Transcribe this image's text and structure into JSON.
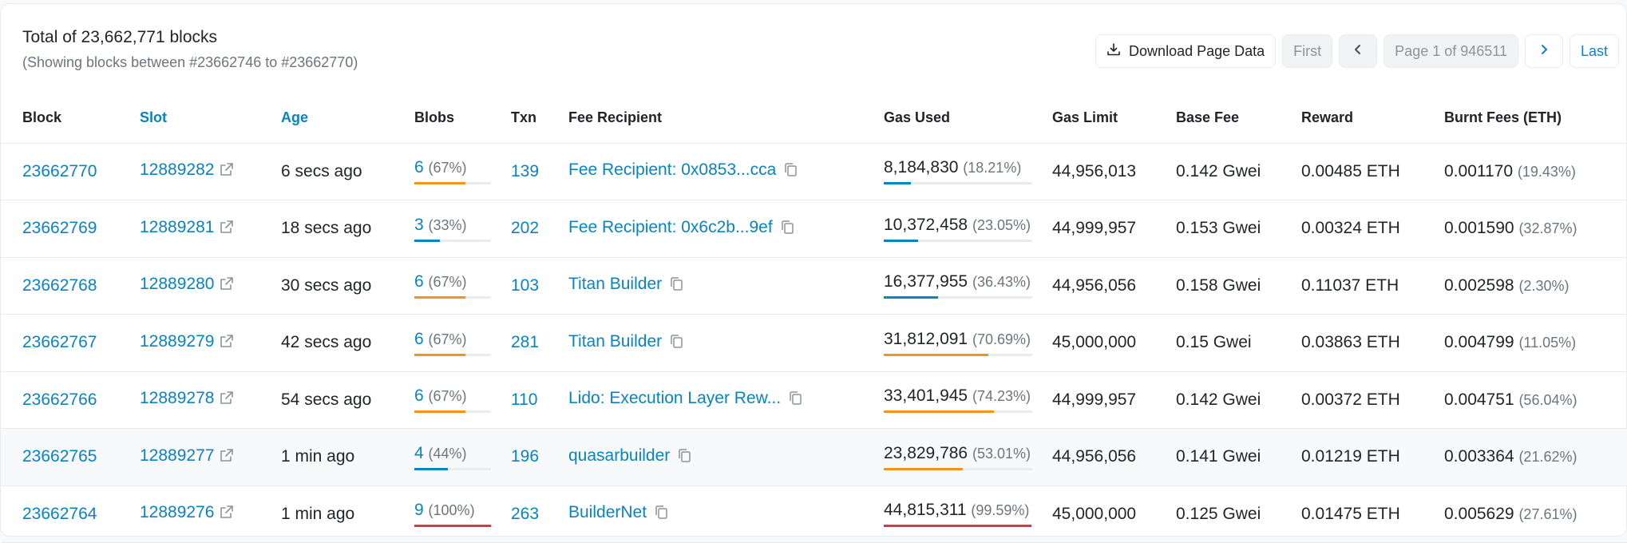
{
  "header": {
    "total": "Total of 23,662,771 blocks",
    "showing": "(Showing blocks between #23662746 to #23662770)"
  },
  "toolbar": {
    "download_label": "Download Page Data",
    "download_icon": "download-icon",
    "first_label": "First",
    "prev_icon": "chevron-left-icon",
    "page_label": "Page 1 of 946511",
    "next_icon": "chevron-right-icon",
    "last_label": "Last"
  },
  "columns": {
    "block": "Block",
    "slot": "Slot",
    "age": "Age",
    "blobs": "Blobs",
    "txn": "Txn",
    "fee_recipient": "Fee Recipient",
    "gas_used": "Gas Used",
    "gas_limit": "Gas Limit",
    "base_fee": "Base Fee",
    "reward": "Reward",
    "burnt_fees": "Burnt Fees (ETH)"
  },
  "colors": {
    "link": "#0784c3",
    "bar_blue": "#0784c3",
    "bar_orange": "#f7931a",
    "bar_red": "#dc3545"
  },
  "rows": [
    {
      "block": "23662770",
      "slot": "12889282",
      "age": "6 secs ago",
      "blobs": "6",
      "blobs_pct": "(67%)",
      "blobs_level": 0.67,
      "txn": "139",
      "fee_recipient": "Fee Recipient: 0x0853...cca",
      "gas_used": "8,184,830",
      "gas_pct": "(18.21%)",
      "gas_level": 0.1821,
      "gas_limit": "44,956,013",
      "base_fee": "0.142 Gwei",
      "reward": "0.00485 ETH",
      "burnt": "0.001170",
      "burnt_pct": "(19.43%)"
    },
    {
      "block": "23662769",
      "slot": "12889281",
      "age": "18 secs ago",
      "blobs": "3",
      "blobs_pct": "(33%)",
      "blobs_level": 0.33,
      "txn": "202",
      "fee_recipient": "Fee Recipient: 0x6c2b...9ef",
      "gas_used": "10,372,458",
      "gas_pct": "(23.05%)",
      "gas_level": 0.2305,
      "gas_limit": "44,999,957",
      "base_fee": "0.153 Gwei",
      "reward": "0.00324 ETH",
      "burnt": "0.001590",
      "burnt_pct": "(32.87%)"
    },
    {
      "block": "23662768",
      "slot": "12889280",
      "age": "30 secs ago",
      "blobs": "6",
      "blobs_pct": "(67%)",
      "blobs_level": 0.67,
      "txn": "103",
      "fee_recipient": "Titan Builder",
      "gas_used": "16,377,955",
      "gas_pct": "(36.43%)",
      "gas_level": 0.3643,
      "gas_limit": "44,956,056",
      "base_fee": "0.158 Gwei",
      "reward": "0.11037 ETH",
      "burnt": "0.002598",
      "burnt_pct": "(2.30%)"
    },
    {
      "block": "23662767",
      "slot": "12889279",
      "age": "42 secs ago",
      "blobs": "6",
      "blobs_pct": "(67%)",
      "blobs_level": 0.67,
      "txn": "281",
      "fee_recipient": "Titan Builder",
      "gas_used": "31,812,091",
      "gas_pct": "(70.69%)",
      "gas_level": 0.7069,
      "gas_limit": "45,000,000",
      "base_fee": "0.15 Gwei",
      "reward": "0.03863 ETH",
      "burnt": "0.004799",
      "burnt_pct": "(11.05%)"
    },
    {
      "block": "23662766",
      "slot": "12889278",
      "age": "54 secs ago",
      "blobs": "6",
      "blobs_pct": "(67%)",
      "blobs_level": 0.67,
      "txn": "110",
      "fee_recipient": "Lido: Execution Layer Rew...",
      "gas_used": "33,401,945",
      "gas_pct": "(74.23%)",
      "gas_level": 0.7423,
      "gas_limit": "44,999,957",
      "base_fee": "0.142 Gwei",
      "reward": "0.00372 ETH",
      "burnt": "0.004751",
      "burnt_pct": "(56.04%)"
    },
    {
      "block": "23662765",
      "slot": "12889277",
      "age": "1 min ago",
      "blobs": "4",
      "blobs_pct": "(44%)",
      "blobs_level": 0.44,
      "txn": "196",
      "fee_recipient": "quasarbuilder",
      "gas_used": "23,829,786",
      "gas_pct": "(53.01%)",
      "gas_level": 0.5301,
      "gas_limit": "44,956,056",
      "base_fee": "0.141 Gwei",
      "reward": "0.01219 ETH",
      "burnt": "0.003364",
      "burnt_pct": "(21.62%)"
    },
    {
      "block": "23662764",
      "slot": "12889276",
      "age": "1 min ago",
      "blobs": "9",
      "blobs_pct": "(100%)",
      "blobs_level": 1.0,
      "txn": "263",
      "fee_recipient": "BuilderNet",
      "gas_used": "44,815,311",
      "gas_pct": "(99.59%)",
      "gas_level": 0.9959,
      "gas_limit": "45,000,000",
      "base_fee": "0.125 Gwei",
      "reward": "0.01475 ETH",
      "burnt": "0.005629",
      "burnt_pct": "(27.61%)"
    }
  ]
}
